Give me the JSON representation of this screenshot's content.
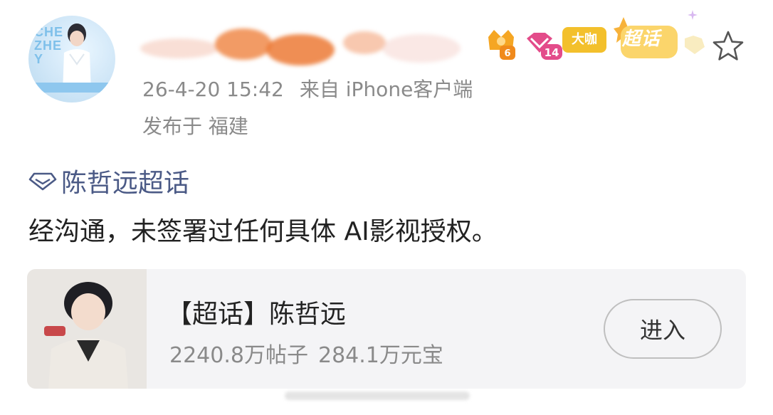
{
  "post": {
    "timestamp": "26-4-20 15:42",
    "source": "来自 iPhone客户端",
    "location": "发布于 福建",
    "topic_tag": "陈哲远超话",
    "content": "经沟通，未签署过任何具体 AI影视授权。"
  },
  "badges": {
    "level_badge": "6",
    "fan_level_badge": "14",
    "dakai_label": "大咖",
    "chaohua_label": "超话"
  },
  "avatar": {
    "text_lines": [
      "CHE",
      "ZHE",
      "Y"
    ]
  },
  "card": {
    "title": "【超话】陈哲远",
    "posts": "2240.8万帖子",
    "yuanbao": "284.1万元宝",
    "enter_label": "进入"
  },
  "icons": {
    "star": "star-outline-icon",
    "topic": "chaohua-diamond-icon"
  },
  "colors": {
    "link": "#4b5a86",
    "meta": "#8a8a8a",
    "card_bg": "#f4f4f6",
    "dakai_badge": "#f3c02c"
  }
}
